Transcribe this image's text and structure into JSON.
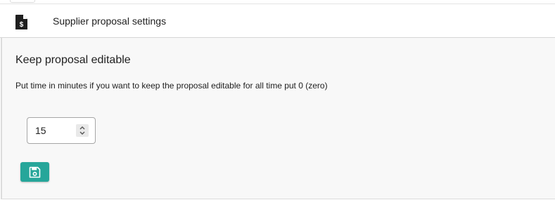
{
  "header": {
    "title": "Supplier proposal settings",
    "icon": "invoice-dollar-file-icon"
  },
  "section": {
    "title": "Keep proposal editable",
    "description": "Put time in minutes if you want to keep the proposal editable for all time put 0 (zero)"
  },
  "editable_minutes": {
    "value": "15",
    "spinner_icons": [
      "chevron-up-icon",
      "chevron-down-icon"
    ]
  },
  "save_button": {
    "icon": "floppy-disk-icon",
    "color": "#26a69a"
  }
}
